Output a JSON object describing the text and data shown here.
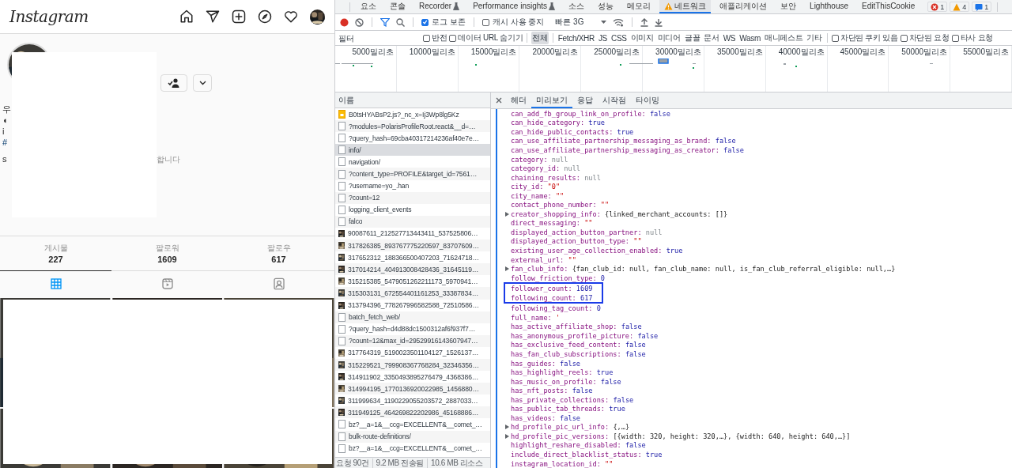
{
  "instagram": {
    "logo": "Instagram",
    "bio_lines": [
      {
        "text": "우",
        "kind": "text"
      },
      {
        "text": "◖",
        "kind": "text"
      },
      {
        "text": "i",
        "kind": "text"
      },
      {
        "text": "#",
        "kind": "link"
      },
      {
        "text": "s",
        "kind": "text",
        "tail": "합니다"
      }
    ],
    "stats": [
      {
        "label": "게시물",
        "value": "227"
      },
      {
        "label": "팔로워",
        "value": "1609"
      },
      {
        "label": "팔로우",
        "value": "617"
      }
    ],
    "profile_tabs": [
      {
        "selected": true
      },
      {
        "selected": false
      },
      {
        "selected": false
      }
    ]
  },
  "devtools": {
    "panel_tabs": [
      {
        "label": "요소",
        "kind": "plain",
        "selected": false
      },
      {
        "label": "콘솔",
        "kind": "plain",
        "selected": false
      },
      {
        "label": "Recorder",
        "kind": "experimental",
        "selected": false
      },
      {
        "label": "Performance insights",
        "kind": "experimental",
        "selected": false
      },
      {
        "label": "소스",
        "kind": "plain",
        "selected": false
      },
      {
        "label": "성능",
        "kind": "plain",
        "selected": false
      },
      {
        "label": "메모리",
        "kind": "plain",
        "selected": false
      },
      {
        "label": "네트워크",
        "kind": "warning",
        "selected": true
      },
      {
        "label": "애플리케이션",
        "kind": "plain",
        "selected": false
      },
      {
        "label": "보안",
        "kind": "plain",
        "selected": false
      },
      {
        "label": "Lighthouse",
        "kind": "plain",
        "selected": false
      },
      {
        "label": "EditThisCookie",
        "kind": "plain",
        "selected": false
      }
    ],
    "issue_badges": [
      {
        "kind": "error",
        "count": "1"
      },
      {
        "kind": "warning",
        "count": "4"
      },
      {
        "kind": "info",
        "count": "1"
      }
    ],
    "toolbar": {
      "recording": true,
      "preserve_log": {
        "label": "로그 보존",
        "checked": true
      },
      "disable_cache": {
        "label": "캐시 사용 중지",
        "checked": false
      },
      "throttling": "빠른 3G"
    },
    "filter": {
      "placeholder": "필터",
      "checks": [
        {
          "label": "반전",
          "checked": false
        },
        {
          "label": "데이터 URL 숨기기",
          "checked": false
        }
      ],
      "types": [
        {
          "label": "전체",
          "selected": true
        },
        {
          "label": "Fetch/XHR",
          "selected": false
        },
        {
          "label": "JS",
          "selected": false
        },
        {
          "label": "CSS",
          "selected": false
        },
        {
          "label": "이미지",
          "selected": false
        },
        {
          "label": "미디어",
          "selected": false
        },
        {
          "label": "글꼴",
          "selected": false
        },
        {
          "label": "문서",
          "selected": false
        },
        {
          "label": "WS",
          "selected": false
        },
        {
          "label": "Wasm",
          "selected": false
        },
        {
          "label": "매니페스트",
          "selected": false
        },
        {
          "label": "기타",
          "selected": false
        }
      ],
      "extra_checks": [
        {
          "label": "차단된 쿠키 있음",
          "checked": false
        },
        {
          "label": "차단된 요청",
          "checked": false
        },
        {
          "label": "타사 요청",
          "checked": false
        }
      ]
    },
    "overview": {
      "ticks": [
        "5000밀리초",
        "10000밀리초",
        "15000밀리초",
        "20000밀리초",
        "25000밀리초",
        "30000밀리초",
        "35000밀리초",
        "40000밀리초",
        "45000밀리초",
        "50000밀리초",
        "55000밀리초"
      ]
    },
    "requests": {
      "header": "이름",
      "rows": [
        {
          "name": "B0tsHYABsP2.js?_nc_x=Ij3Wp8lg5Kz",
          "kind": "script",
          "selected": false
        },
        {
          "name": "?modules=PolarisProfileRoot.react&__d=…",
          "kind": "document",
          "selected": false
        },
        {
          "name": "?query_hash=69cba40317214236af40e7e…",
          "kind": "document",
          "selected": false
        },
        {
          "name": "info/",
          "kind": "document",
          "selected": true
        },
        {
          "name": "navigation/",
          "kind": "document",
          "selected": false
        },
        {
          "name": "?content_type=PROFILE&target_id=7561…",
          "kind": "document",
          "selected": false
        },
        {
          "name": "?username=yo_.han",
          "kind": "document",
          "selected": false
        },
        {
          "name": "?count=12",
          "kind": "document",
          "selected": false
        },
        {
          "name": "logging_client_events",
          "kind": "document",
          "selected": false
        },
        {
          "name": "falco",
          "kind": "document",
          "selected": false
        },
        {
          "name": "90087611_212527713443411_537525806…",
          "selected": false
        },
        {
          "name": "317826385_893767775220597_83707609…",
          "selected": false
        },
        {
          "name": "317652312_188366500407203_71624718…",
          "selected": false
        },
        {
          "name": "317014214_404913008428436_31645119…",
          "selected": false
        },
        {
          "name": "315215385_5479051262211173_5970941…",
          "selected": false
        },
        {
          "name": "315303131_672554401161253_33387834…",
          "selected": false
        },
        {
          "name": "313794396_778267996582588_72510586…",
          "selected": false
        },
        {
          "name": "batch_fetch_web/",
          "kind": "document",
          "selected": false
        },
        {
          "name": "?query_hash=d4d88dc1500312af6f937f7…",
          "kind": "document",
          "selected": false
        },
        {
          "name": "?count=12&max_id=29529916143607947…",
          "kind": "document",
          "selected": false
        },
        {
          "name": "317764319_5190023501104127_1526137…",
          "selected": false
        },
        {
          "name": "315229521_799908367768284_32346356…",
          "selected": false
        },
        {
          "name": "314911902_3350493895276479_4368386…",
          "selected": false
        },
        {
          "name": "314994195_1770136920022985_1456880…",
          "selected": false
        },
        {
          "name": "311999634_1190229055203572_2887033…",
          "selected": false
        },
        {
          "name": "311949125_464269822202986_45168886…",
          "selected": false
        },
        {
          "name": "bz?__a=1&__ccg=EXCELLENT&__comet_…",
          "kind": "document",
          "selected": false
        },
        {
          "name": "bulk-route-definitions/",
          "kind": "document",
          "selected": false
        },
        {
          "name": "bz?__a=1&__ccg=EXCELLENT&__comet_…",
          "kind": "document",
          "selected": false
        }
      ],
      "summary": [
        "요청 90건",
        "9.2 MB 전송됨",
        "10.6 MB 리소스"
      ]
    },
    "detail": {
      "tabs": [
        {
          "label": "헤더",
          "selected": false
        },
        {
          "label": "미리보기",
          "selected": true
        },
        {
          "label": "응답",
          "selected": false
        },
        {
          "label": "시작점",
          "selected": false
        },
        {
          "label": "타이밍",
          "selected": false
        }
      ],
      "lines": [
        {
          "key": "can_add_fb_group_link_on_profile:",
          "value": "false",
          "kind": "bool",
          "expandable": false,
          "boxed": false
        },
        {
          "key": "can_hide_category:",
          "value": "true",
          "kind": "bool",
          "expandable": false,
          "boxed": false
        },
        {
          "key": "can_hide_public_contacts:",
          "value": "true",
          "kind": "bool",
          "expandable": false,
          "boxed": false
        },
        {
          "key": "can_use_affiliate_partnership_messaging_as_brand:",
          "value": "false",
          "kind": "bool",
          "expandable": false,
          "boxed": false
        },
        {
          "key": "can_use_affiliate_partnership_messaging_as_creator:",
          "value": "false",
          "kind": "bool",
          "expandable": false,
          "boxed": false
        },
        {
          "key": "category:",
          "value": "null",
          "kind": "null",
          "expandable": false,
          "boxed": false
        },
        {
          "key": "category_id:",
          "value": "null",
          "kind": "null",
          "expandable": false,
          "boxed": false
        },
        {
          "key": "chaining_results:",
          "value": "null",
          "kind": "null",
          "expandable": false,
          "boxed": false
        },
        {
          "key": "city_id:",
          "value": "\"0\"",
          "kind": "string",
          "expandable": false,
          "boxed": false
        },
        {
          "key": "city_name:",
          "value": "\"\"",
          "kind": "string",
          "expandable": false,
          "boxed": false
        },
        {
          "key": "contact_phone_number:",
          "value": "\"\"",
          "kind": "string",
          "expandable": false,
          "boxed": false
        },
        {
          "key": "creator_shopping_info:",
          "value": "{linked_merchant_accounts: []}",
          "kind": "object",
          "expandable": true,
          "boxed": false
        },
        {
          "key": "direct_messaging:",
          "value": "\"\"",
          "kind": "string",
          "expandable": false,
          "boxed": false
        },
        {
          "key": "displayed_action_button_partner:",
          "value": "null",
          "kind": "null",
          "expandable": false,
          "boxed": false
        },
        {
          "key": "displayed_action_button_type:",
          "value": "\"\"",
          "kind": "string",
          "expandable": false,
          "boxed": false
        },
        {
          "key": "existing_user_age_collection_enabled:",
          "value": "true",
          "kind": "bool",
          "expandable": false,
          "boxed": false
        },
        {
          "key": "external_url:",
          "value": "\"\"",
          "kind": "string",
          "expandable": false,
          "boxed": false
        },
        {
          "key": "fan_club_info:",
          "value": "{fan_club_id: null, fan_club_name: null, is_fan_club_referral_eligible: null,…}",
          "kind": "object",
          "expandable": true,
          "boxed": false
        },
        {
          "key": "follow_friction_type:",
          "value": "0",
          "kind": "number",
          "expandable": false,
          "boxed": false
        },
        {
          "key": "follower_count:",
          "value": "1609",
          "kind": "number",
          "expandable": false,
          "boxed": true
        },
        {
          "key": "following_count:",
          "value": "617",
          "kind": "number",
          "expandable": false,
          "boxed": true
        },
        {
          "key": "following_tag_count:",
          "value": "0",
          "kind": "number",
          "expandable": false,
          "boxed": false
        },
        {
          "key": "full_name:",
          "value": "'",
          "kind": "string",
          "expandable": false,
          "boxed": false
        },
        {
          "key": "has_active_affiliate_shop:",
          "value": "false",
          "kind": "bool",
          "expandable": false,
          "boxed": false
        },
        {
          "key": "has_anonymous_profile_picture:",
          "value": "false",
          "kind": "bool",
          "expandable": false,
          "boxed": false
        },
        {
          "key": "has_exclusive_feed_content:",
          "value": "false",
          "kind": "bool",
          "expandable": false,
          "boxed": false
        },
        {
          "key": "has_fan_club_subscriptions:",
          "value": "false",
          "kind": "bool",
          "expandable": false,
          "boxed": false
        },
        {
          "key": "has_guides:",
          "value": "false",
          "kind": "bool",
          "expandable": false,
          "boxed": false
        },
        {
          "key": "has_highlight_reels:",
          "value": "true",
          "kind": "bool",
          "expandable": false,
          "boxed": false
        },
        {
          "key": "has_music_on_profile:",
          "value": "false",
          "kind": "bool",
          "expandable": false,
          "boxed": false
        },
        {
          "key": "has_nft_posts:",
          "value": "false",
          "kind": "bool",
          "expandable": false,
          "boxed": false
        },
        {
          "key": "has_private_collections:",
          "value": "false",
          "kind": "bool",
          "expandable": false,
          "boxed": false
        },
        {
          "key": "has_public_tab_threads:",
          "value": "true",
          "kind": "bool",
          "expandable": false,
          "boxed": false
        },
        {
          "key": "has_videos:",
          "value": "false",
          "kind": "bool",
          "expandable": false,
          "boxed": false
        },
        {
          "key": "hd_profile_pic_url_info:",
          "value": "{,…}",
          "kind": "object",
          "expandable": true,
          "boxed": false
        },
        {
          "key": "hd_profile_pic_versions:",
          "value": "[{width: 320, height: 320,…}, {width: 640, height: 640,…}]",
          "kind": "object",
          "expandable": true,
          "boxed": false
        },
        {
          "key": "highlight_reshare_disabled:",
          "value": "false",
          "kind": "bool",
          "expandable": false,
          "boxed": false
        },
        {
          "key": "include_direct_blacklist_status:",
          "value": "true",
          "kind": "bool",
          "expandable": false,
          "boxed": false
        },
        {
          "key": "instagram_location_id:",
          "value": "\"\"",
          "kind": "string",
          "expandable": false,
          "boxed": false
        }
      ]
    }
  }
}
